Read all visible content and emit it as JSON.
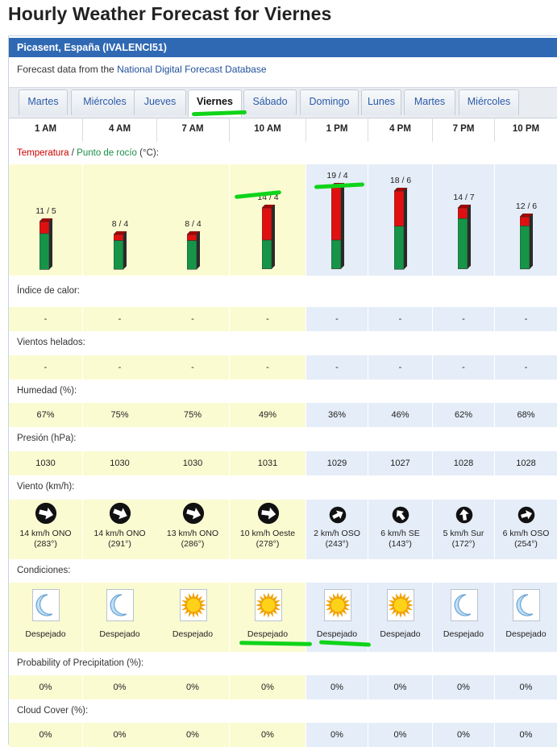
{
  "title": "Hourly Weather Forecast for Viernes",
  "station": "Picasent, España (IVALENCI51)",
  "source_prefix": "Forecast data from the ",
  "source_link": "National Digital Forecast Database",
  "tabs": [
    "Martes",
    "Miércoles",
    "Jueves",
    "Viernes",
    "Sábado",
    "Domingo",
    "Lunes",
    "Martes",
    "Miércoles"
  ],
  "active_tab": 3,
  "times": [
    "1 AM",
    "4 AM",
    "7 AM",
    "10 AM",
    "1 PM",
    "4 PM",
    "7 PM",
    "10 PM"
  ],
  "temp_label_t": "Temperatura",
  "temp_label_sep": " / ",
  "temp_label_d": "Punto de rocío",
  "temp_label_unit": " (°C):",
  "temps": [
    "11 / 5",
    "8 / 4",
    "8 / 4",
    "14 / 4",
    "19 / 4",
    "18 / 6",
    "14 / 7",
    "12 / 6"
  ],
  "temp_values": [
    11,
    8,
    8,
    14,
    19,
    18,
    14,
    12
  ],
  "dew_values": [
    5,
    4,
    4,
    4,
    4,
    6,
    7,
    6
  ],
  "heat_label": "Índice de calor:",
  "heat": [
    "-",
    "-",
    "-",
    "-",
    "-",
    "-",
    "-",
    "-"
  ],
  "chill_label": "Vientos helados:",
  "chill": [
    "-",
    "-",
    "-",
    "-",
    "-",
    "-",
    "-",
    "-"
  ],
  "humidity_label": "Humedad (%):",
  "humidity": [
    "67%",
    "75%",
    "75%",
    "49%",
    "36%",
    "46%",
    "62%",
    "68%"
  ],
  "pressure_label": "Presión (hPa):",
  "pressure": [
    "1030",
    "1030",
    "1030",
    "1031",
    "1029",
    "1027",
    "1028",
    "1028"
  ],
  "wind_label": "Viento (km/h):",
  "wind_speed": [
    "14 km/h ONO",
    "14 km/h ONO",
    "13 km/h ONO",
    "10 km/h Oeste",
    "2 km/h OSO",
    "6 km/h SE",
    "5 km/h Sur",
    "6 km/h OSO"
  ],
  "wind_deg": [
    "(283°)",
    "(291°)",
    "(286°)",
    "(278°)",
    "(243°)",
    "(143°)",
    "(172°)",
    "(254°)"
  ],
  "cond_label": "Condiciones:",
  "conditions": [
    "Despejado",
    "Despejado",
    "Despejado",
    "Despejado",
    "Despejado",
    "Despejado",
    "Despejado",
    "Despejado"
  ],
  "cond_icons": [
    "moon-icon",
    "moon-icon",
    "sun-icon",
    "sun-icon",
    "sun-icon",
    "sun-icon",
    "moon-icon",
    "moon-icon"
  ],
  "pop_label": "Probability of Precipitation (%):",
  "pop": [
    "0%",
    "0%",
    "0%",
    "0%",
    "0%",
    "0%",
    "0%",
    "0%"
  ],
  "cloud_label": "Cloud Cover (%):",
  "cloud": [
    "0%",
    "0%",
    "0%",
    "0%",
    "0%",
    "0%",
    "0%",
    "0%"
  ],
  "colors": {
    "header": "#2f69b4",
    "temp": "#cc0000",
    "dew": "#1a8f45",
    "day": "#fbfbd2",
    "night": "#e5edf8",
    "marker": "#0fd41a"
  }
}
